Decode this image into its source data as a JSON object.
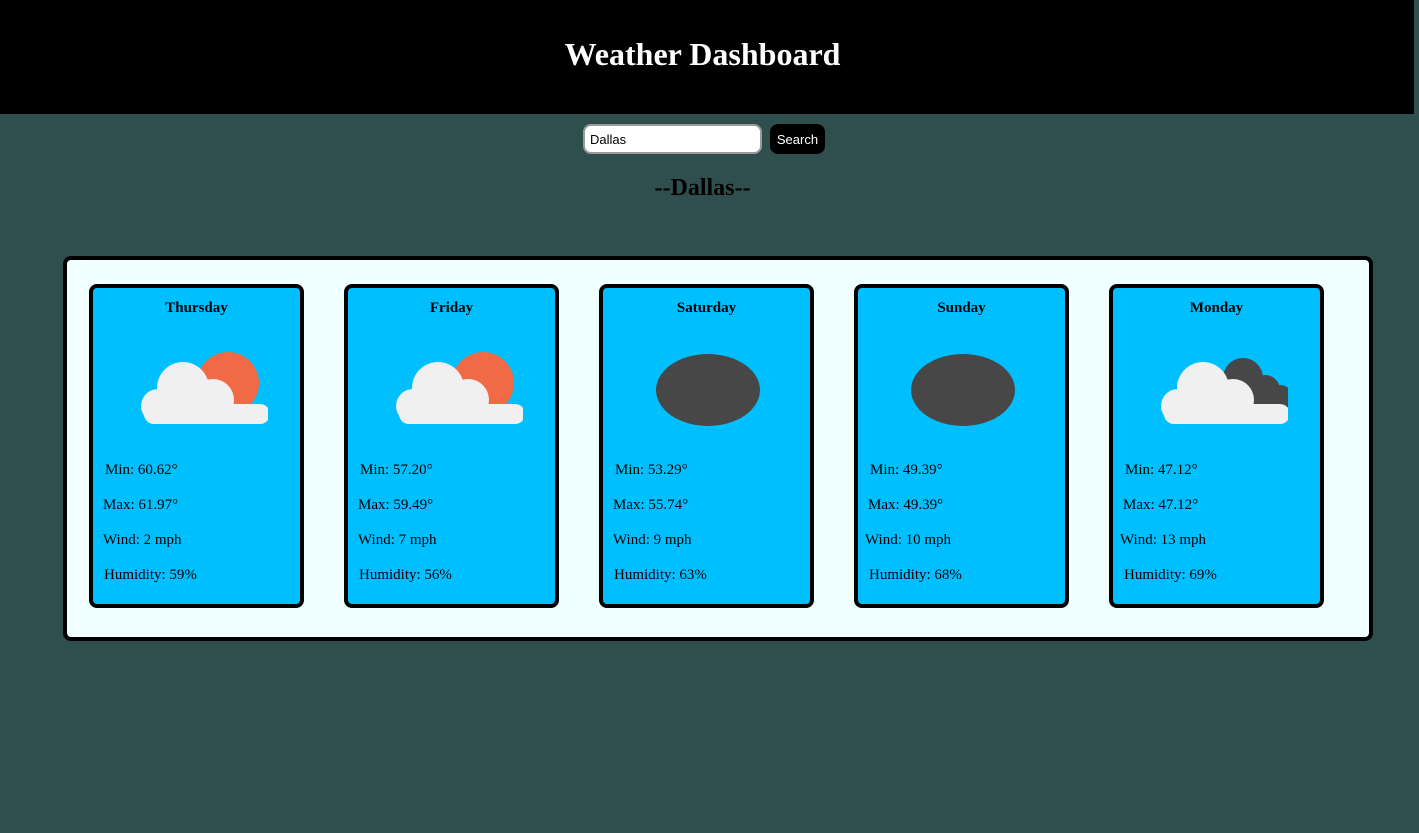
{
  "header": {
    "title": "Weather Dashboard"
  },
  "search": {
    "value": "Dallas",
    "button_label": "Search"
  },
  "city": {
    "title": "--Dallas--"
  },
  "forecast": [
    {
      "day": "Thursday",
      "icon": "partly-cloudy-day-icon",
      "min": "Min: 60.62°",
      "max": "Max: 61.97°",
      "wind": "Wind: 2 mph",
      "humidity": "Humidity: 59%"
    },
    {
      "day": "Friday",
      "icon": "partly-cloudy-day-icon",
      "min": "Min: 57.20°",
      "max": "Max: 59.49°",
      "wind": "Wind: 7 mph",
      "humidity": "Humidity: 56%"
    },
    {
      "day": "Saturday",
      "icon": "rain-cloud-icon",
      "min": "Min: 53.29°",
      "max": "Max: 55.74°",
      "wind": "Wind: 9 mph",
      "humidity": "Humidity: 63%"
    },
    {
      "day": "Sunday",
      "icon": "rain-cloud-icon",
      "min": "Min: 49.39°",
      "max": "Max: 49.39°",
      "wind": "Wind: 10 mph",
      "humidity": "Humidity: 68%"
    },
    {
      "day": "Monday",
      "icon": "broken-clouds-icon",
      "min": "Min: 47.12°",
      "max": "Max: 47.12°",
      "wind": "Wind: 13 mph",
      "humidity": "Humidity: 69%"
    }
  ],
  "colors": {
    "page_background": "#2f4f4f",
    "header_background": "#000000",
    "panel_background": "#f0ffff",
    "card_background": "#00bfff",
    "sun": "#ef6a45",
    "cloud_light": "#f0f0f0",
    "cloud_dark": "#474747"
  }
}
